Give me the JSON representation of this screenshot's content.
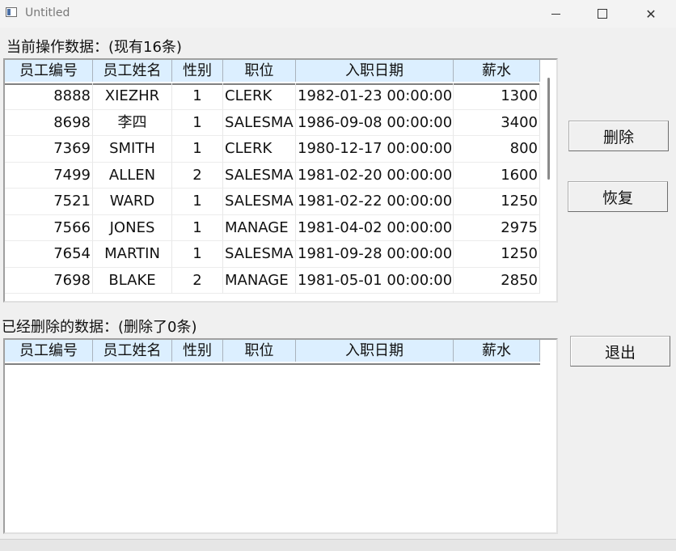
{
  "window": {
    "title": "Untitled",
    "minimize": "",
    "maximize": "",
    "close": "✕"
  },
  "current_label": "当前操作数据：(现有16条)",
  "deleted_label": "已经删除的数据：(删除了0条)",
  "columns": [
    "员工编号",
    "员工姓名",
    "性别",
    "职位",
    "入职日期",
    "薪水"
  ],
  "rows": [
    [
      "8888",
      "XIEZHR",
      "1",
      "CLERK",
      "1982-01-23 00:00:00",
      "1300"
    ],
    [
      "8698",
      "李四",
      "1",
      "SALESMA",
      "1986-09-08 00:00:00",
      "3400"
    ],
    [
      "7369",
      "SMITH",
      "1",
      "CLERK",
      "1980-12-17 00:00:00",
      "800"
    ],
    [
      "7499",
      "ALLEN",
      "2",
      "SALESMA",
      "1981-02-20 00:00:00",
      "1600"
    ],
    [
      "7521",
      "WARD",
      "1",
      "SALESMA",
      "1981-02-22 00:00:00",
      "1250"
    ],
    [
      "7566",
      "JONES",
      "1",
      "MANAGE",
      "1981-04-02 00:00:00",
      "2975"
    ],
    [
      "7654",
      "MARTIN",
      "1",
      "SALESMA",
      "1981-09-28 00:00:00",
      "1250"
    ],
    [
      "7698",
      "BLAKE",
      "2",
      "MANAGE",
      "1981-05-01 00:00:00",
      "2850"
    ]
  ],
  "buttons": {
    "delete": "删除",
    "restore": "恢复",
    "exit": "退出"
  }
}
